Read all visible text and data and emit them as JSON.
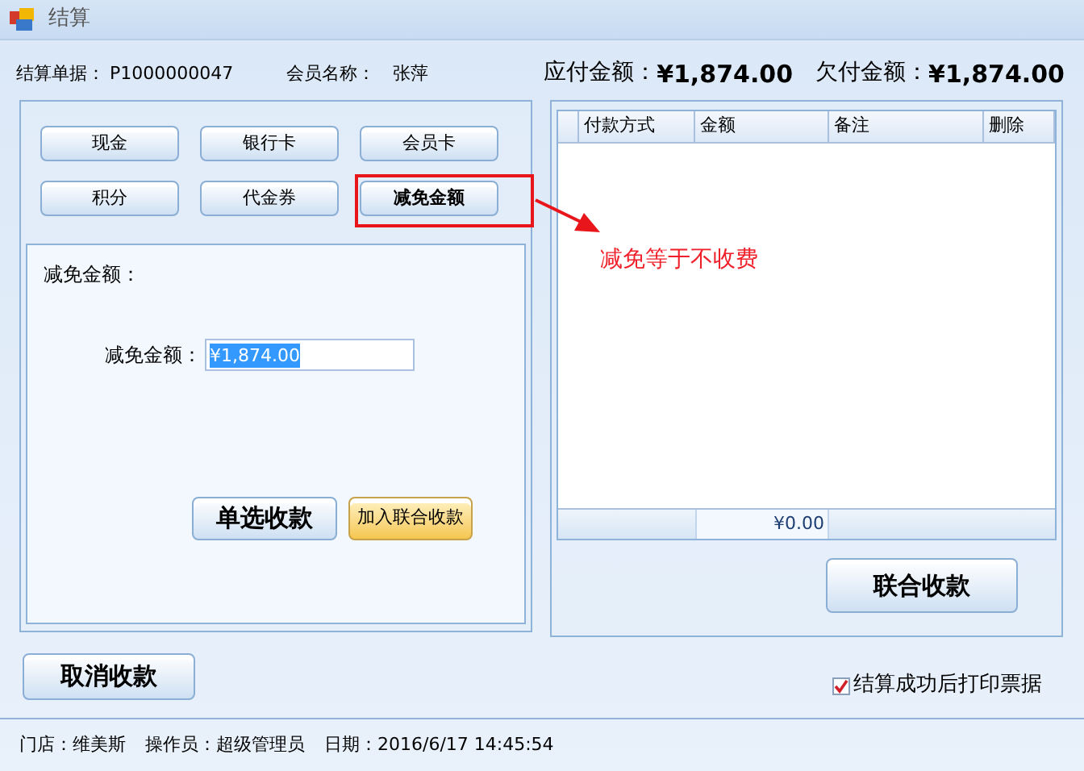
{
  "window": {
    "title": "结算"
  },
  "header": {
    "bill_label": "结算单据：",
    "bill_no": "P1000000047",
    "member_label": "会员名称：",
    "member_name": "张萍",
    "due_label": "应付金额：",
    "due": "¥1,874.00",
    "owed_label": "欠付金额：",
    "owed": "¥1,874.00"
  },
  "payment_methods": [
    {
      "label": "现金",
      "selected": false
    },
    {
      "label": "银行卡",
      "selected": false
    },
    {
      "label": "会员卡",
      "selected": false
    },
    {
      "label": "积分",
      "selected": false
    },
    {
      "label": "代金券",
      "selected": false
    },
    {
      "label": "减免金额",
      "selected": true
    }
  ],
  "discount_panel": {
    "title": "减免金额：",
    "field_label": "减免金额：",
    "value": "¥1,874.00",
    "buttons": [
      {
        "label": "单选收款",
        "kind": "normal"
      },
      {
        "label": "加入联合收款",
        "kind": "highlight"
      }
    ]
  },
  "payments_table": {
    "columns": [
      "付款方式",
      "金额",
      "备注",
      "删除"
    ],
    "total": "¥0.00"
  },
  "combined_button": "联合收款",
  "cancel_button": "取消收款",
  "print_checkbox": {
    "label": "结算成功后打印票据",
    "checked": true
  },
  "status_bar": [
    "门店：维美斯",
    "操作员：超级管理员",
    "日期：2016/6/17 14:45:54"
  ],
  "annotation": {
    "text": "减免等于不收费"
  }
}
